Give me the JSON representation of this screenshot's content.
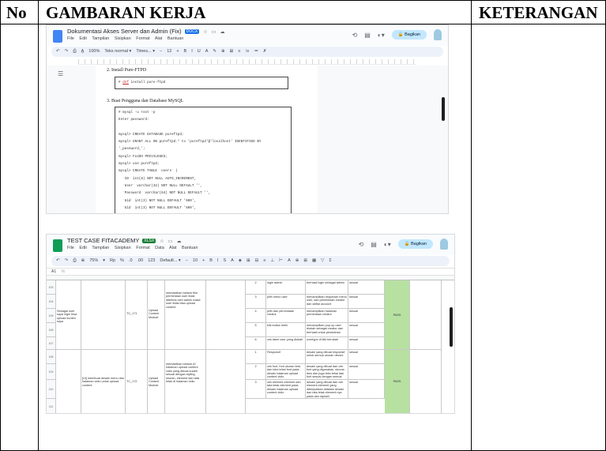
{
  "table": {
    "header_no": "No",
    "header_gambaran": "GAMBARAN KERJA",
    "header_keterangan": "KETERANGAN"
  },
  "doc_screenshot": {
    "title": "Dokumentasi Akses Server dan Admin (Fix)",
    "badge": "DOCX",
    "menus": [
      "File",
      "Edit",
      "Tampilan",
      "Sisipkan",
      "Format",
      "Alat",
      "Bantuan"
    ],
    "share_label": "Bagikan",
    "toolbar_items": [
      "↶",
      "↷",
      "⎙",
      "A̲",
      "100%",
      "Teks normal ▾",
      "Times... ▾",
      "−",
      "12",
      "+",
      "B",
      "I",
      "U",
      "A",
      "✎",
      "⊕",
      "⊞",
      "≡",
      "⁝≡",
      "≔",
      "✗"
    ],
    "step2": "2.  Install Pure-FTPD",
    "step2_code": "# dnf install pure-ftpd",
    "step3": "3.  Buat Pengguna dan Database MySQL",
    "code_lines": [
      "# mysql -u root -p",
      "Enter password:",
      "",
      "mysql> CREATE DATABASE pureftpd;",
      "mysql> GRANT ALL ON pureftpd.* to 'pureftpd'@'localhost' IDENTIFIED BY",
      "'_password_';",
      "mysql> FLUSH PRIVILEGES;",
      "mysql> use pureftpd;",
      "mysql> CREATE TABLE `users` (",
      "  `ID` int(8) NOT NULL AUTO_INCREMENT,",
      "  `User` varchar(32) NOT NULL DEFAULT '',",
      "  `Password` varchar(64) NOT NULL DEFAULT '',",
      "  `Uid` int(3) NOT NULL DEFAULT '500',",
      "  `Gid` int(3) NOT NULL DEFAULT '500',",
      "  `Dir` varchar(255) NOT NULL DEFAULT '',"
    ]
  },
  "sheet_screenshot": {
    "title": "TEST CASE FITACADEMY",
    "badge": "XLSX",
    "menus": [
      "File",
      "Edit",
      "Tampilan",
      "Sisipkan",
      "Format",
      "Data",
      "Alat",
      "Bantuan"
    ],
    "share_label": "Bagikan",
    "toolbar_items": [
      "↶",
      "↷",
      "⎙",
      "⊕",
      "75%",
      "▾",
      "Rp",
      "%",
      ".0",
      ".00",
      "123",
      "Default... ▾",
      "−",
      "10",
      "+",
      "B",
      "I",
      "S",
      "A",
      "◈",
      "⊞",
      "⊟",
      "≡",
      "⊥",
      "⊢",
      "A",
      "⊕",
      "⊞",
      "▦",
      "▽",
      "Σ"
    ],
    "cell_ref": "A1",
    "fx": "fx",
    "rows": [
      {
        "step": "2",
        "action": "login admin",
        "expected": "berhasil login sebagai admin",
        "result": "sesuai"
      },
      {
        "step": "3",
        "action": "pilih menu user",
        "expected": "menampilkan dropdown menu user, dan permintaan creator dan daftar account",
        "result": "sesuai"
      },
      {
        "step": "4",
        "action": "pilih dan permintaan creator",
        "expected": "menampilkan halaman permintaan creator",
        "result": "sesuai"
      },
      {
        "step": "5",
        "action": "klik button lebih",
        "expected": "menampilkan pop-up user diubah sebagai creator dan berhasil untuk perubahan",
        "result": "sesuai"
      },
      {
        "step": "6",
        "action": "cek tabel user yang diubah",
        "expected": "overtype di klik berubah",
        "result": "sesuai"
      },
      {
        "step": "1",
        "action": "Responsif",
        "expected": "desain yang dibuat responsif untuk semua ukuran device",
        "result": "sesuai"
      },
      {
        "step": "2",
        "action": "cek font, font ukuran teks dan teks tebal font pada desain halaman upload content vidio",
        "expected": "desain yang dibuat dan cek font yang digunakan, ukuran teks dan juga teks tebal dan font sesuai dengan semua user",
        "result": "sesuai"
      },
      {
        "step": "3",
        "action": "cek element-element dan tata letak element pada desain halaman upload content vidio",
        "expected": "desain yang dibuat dan cek element-element yang ditempatkan didalam desain dan tata letak element nya pada dan rapiseh",
        "result": "sesuai"
      }
    ],
    "scenario1": "Sebagai user saya ingin bisa upload konten saya",
    "tc1_id": "TC_171",
    "tc1_page": "Upload Content Module",
    "tc1_desc": "memastikan bahwa fitur permintaan user tidak diterima oleh admin maka user tidak bisa upload content",
    "tc2_id": "TC_172",
    "tc2_page": "Upload Content Module",
    "tc2_desc": "memastikan bahwa UI halaman upload content vidio yang dibuat sudah sesuai dengan styling, ukuran, element dan tata letak di halaman vidio",
    "scenario2": "[UI] membuat desain menu dan halaman vidio untuk upload content",
    "pass_label": "PASS",
    "row_numbers": [
      "103",
      "104",
      "105",
      "106",
      "107",
      "108",
      "109",
      "110",
      "111"
    ]
  },
  "colors": {
    "docs_blue": "#4285f4",
    "sheets_green": "#0f9d58",
    "badge_blue": "#1a73e8",
    "badge_green": "#188038",
    "pass_green": "#b7e1a1",
    "share_blue": "#c2e7ff"
  }
}
